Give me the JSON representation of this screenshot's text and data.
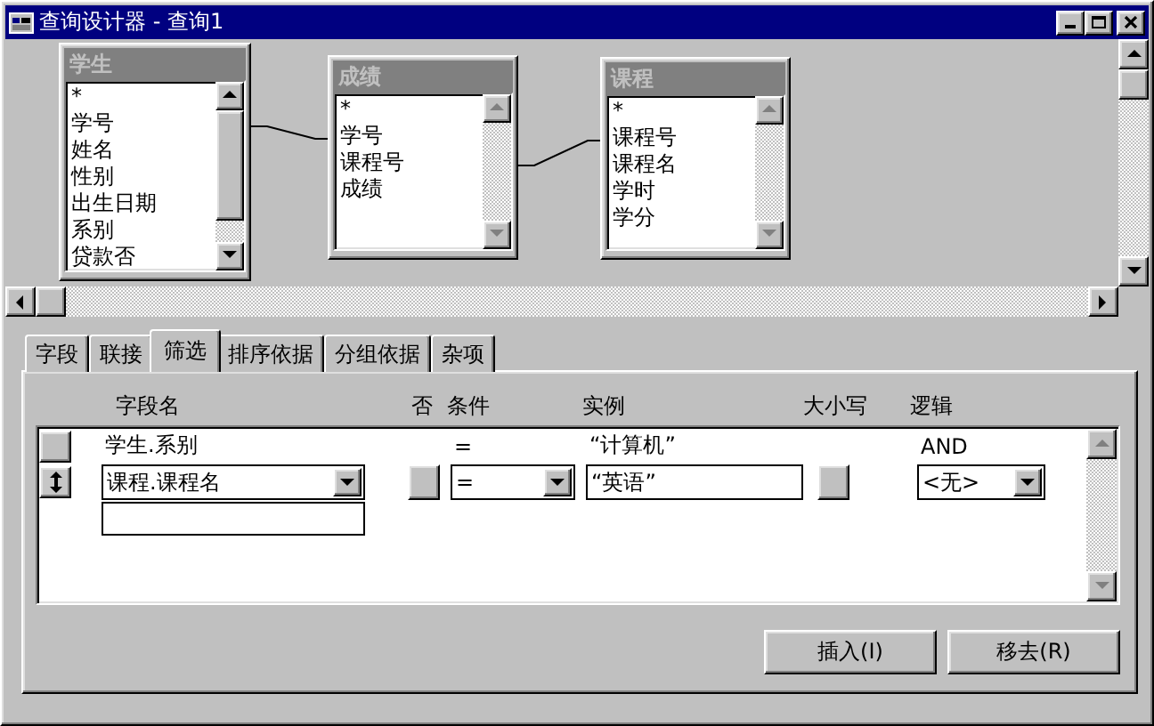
{
  "window": {
    "title": "查询设计器 - 查询1"
  },
  "tables": [
    {
      "name": "学生",
      "fields": [
        "*",
        "学号",
        "姓名",
        "性别",
        "出生日期",
        "系别",
        "贷款否"
      ],
      "scroll_enabled": true
    },
    {
      "name": "成绩",
      "fields": [
        "*",
        "学号",
        "课程号",
        "成绩"
      ],
      "scroll_enabled": false
    },
    {
      "name": "课程",
      "fields": [
        "*",
        "课程号",
        "课程名",
        "学时",
        "学分"
      ],
      "scroll_enabled": false
    }
  ],
  "tabs": [
    {
      "label": "字段",
      "selected": false
    },
    {
      "label": "联接",
      "selected": false
    },
    {
      "label": "筛选",
      "selected": true
    },
    {
      "label": "排序依据",
      "selected": false
    },
    {
      "label": "分组依据",
      "selected": false
    },
    {
      "label": "杂项",
      "selected": false
    }
  ],
  "filter": {
    "columns": [
      "字段名",
      "否",
      "条件",
      "实例",
      "大小写",
      "逻辑"
    ],
    "rows": [
      {
        "kind": "text",
        "current": false,
        "field": "学生.系别",
        "condition": "=",
        "example": "“计算机”",
        "logic": "AND"
      },
      {
        "kind": "edit",
        "current": true,
        "field": "课程.课程名",
        "not": false,
        "condition": "=",
        "example": "“英语”",
        "case": false,
        "logic": "<无>"
      },
      {
        "kind": "new"
      }
    ]
  },
  "buttons": [
    "插入(I)",
    "移去(R)"
  ]
}
